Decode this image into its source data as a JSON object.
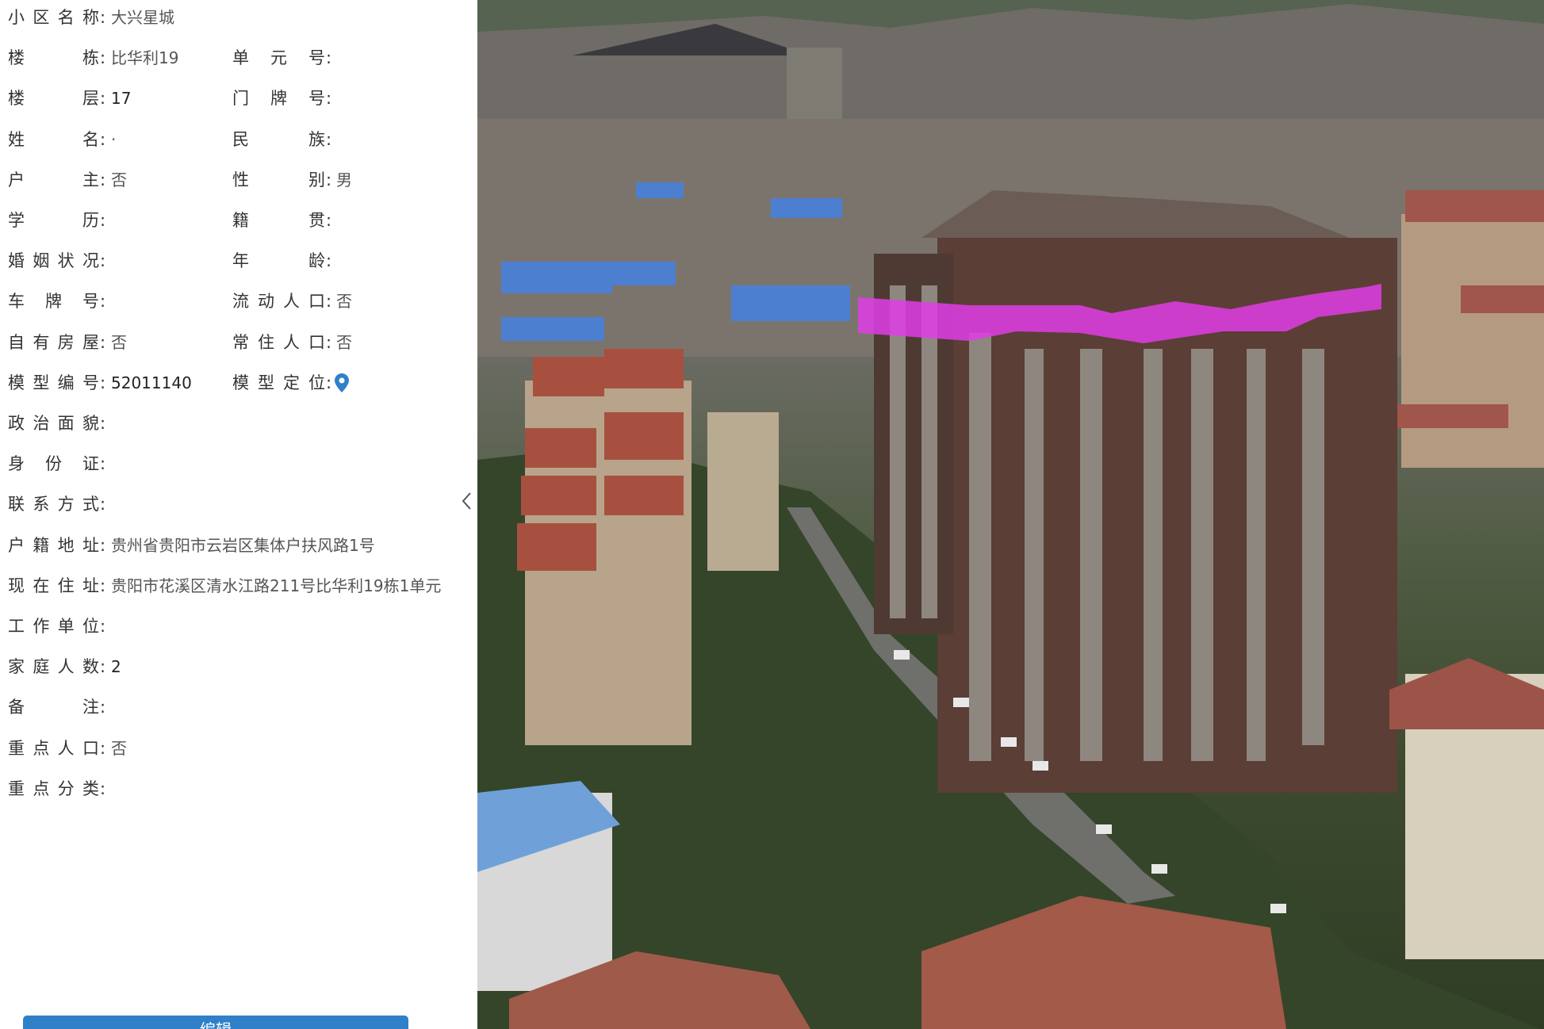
{
  "panel": {
    "rows": [
      {
        "label": "小区名称",
        "value": "大兴星城",
        "label2": null,
        "value2": null
      },
      {
        "label": "楼栋",
        "value": "比华利19",
        "label2": "单元号",
        "value2": ""
      },
      {
        "label": "楼层",
        "value": "17",
        "label2": "门牌号",
        "value2": ""
      },
      {
        "label": "姓名",
        "value": "·",
        "label2": "民族",
        "value2": ""
      },
      {
        "label": "户主",
        "value": "否",
        "label2": "性别",
        "value2": "男"
      },
      {
        "label": "学历",
        "value": "",
        "label2": "籍贯",
        "value2": ""
      },
      {
        "label": "婚姻状况",
        "value": "",
        "label2": "年龄",
        "value2": ""
      },
      {
        "label": "车牌号",
        "value": "",
        "label2": "流动人口",
        "value2": "否"
      },
      {
        "label": "自有房屋",
        "value": "否",
        "label2": "常住人口",
        "value2": "否"
      },
      {
        "label": "模型编号",
        "value": "52011140",
        "label2": "模型定位",
        "value2": ""
      },
      {
        "label": "政治面貌",
        "value": ""
      },
      {
        "label": "身份证",
        "value": ""
      },
      {
        "label": "联系方式",
        "value": ""
      },
      {
        "label": "户籍地址",
        "value": "贵州省贵阳市云岩区集体户扶风路1号"
      },
      {
        "label": "现在住址",
        "value": "贵阳市花溪区清水江路211号比华利19栋1单元"
      },
      {
        "label": "工作单位",
        "value": ""
      },
      {
        "label": "家庭人数",
        "value": "2"
      },
      {
        "label": "备注",
        "value": ""
      },
      {
        "label": "重点人口",
        "value": "否"
      },
      {
        "label": "重点分类",
        "value": ""
      }
    ],
    "colon": ":",
    "bottom_button_label": "编辑",
    "collapse_icon": "chevron-left-icon",
    "locate_icon": "map-pin-icon",
    "accent_color": "#2f80c9"
  },
  "map": {
    "highlight_color": "#e03de6"
  }
}
